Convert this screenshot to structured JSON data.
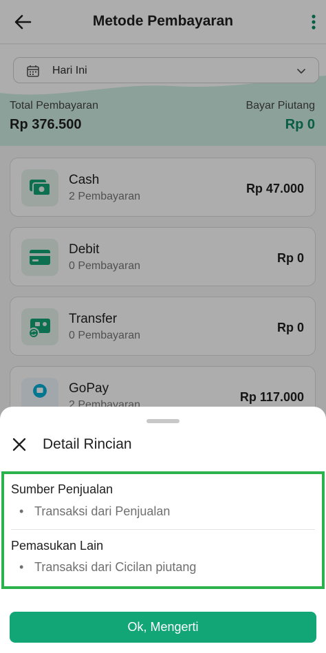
{
  "appbar": {
    "title": "Metode Pembayaran"
  },
  "filter": {
    "date_label": "Hari Ini"
  },
  "summary": {
    "total_label": "Total Pembayaran",
    "total_value": "Rp 376.500",
    "piutang_label": "Bayar Piutang",
    "piutang_value": "Rp 0"
  },
  "methods": [
    {
      "name": "Cash",
      "count": "2 Pembayaran",
      "amount": "Rp 47.000",
      "icon": "cash-icon"
    },
    {
      "name": "Debit",
      "count": "0 Pembayaran",
      "amount": "Rp 0",
      "icon": "debit-card-icon"
    },
    {
      "name": "Transfer",
      "count": "0 Pembayaran",
      "amount": "Rp 0",
      "icon": "transfer-icon"
    },
    {
      "name": "GoPay",
      "count": "2 Pembayaran",
      "amount": "Rp 117.000",
      "icon": "gopay-logo-icon",
      "logo_text": "gopay"
    }
  ],
  "sheet": {
    "title": "Detail Rincian",
    "sections": [
      {
        "title": "Sumber Penjualan",
        "items": [
          "Transaksi dari Penjualan"
        ]
      },
      {
        "title": "Pemasukan Lain",
        "items": [
          "Transaksi dari Cicilan piutang"
        ]
      }
    ],
    "ok_label": "Ok, Mengerti"
  },
  "colors": {
    "brand": "#12a677",
    "highlight_border": "#2bb24c",
    "positive": "#0e8a65"
  }
}
